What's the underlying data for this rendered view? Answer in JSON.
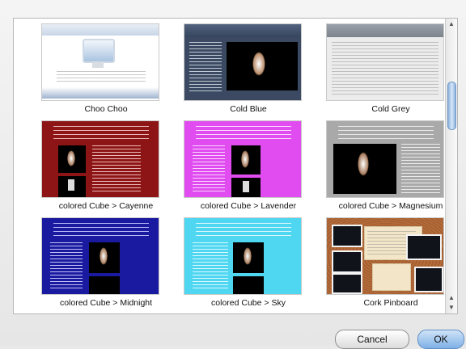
{
  "templates": [
    {
      "label": "Choo Choo",
      "style": "choo"
    },
    {
      "label": "Cold Blue",
      "style": "coldblue"
    },
    {
      "label": "Cold Grey",
      "style": "coldgrey"
    },
    {
      "label": "colored Cube > Cayenne",
      "style": "cayenne"
    },
    {
      "label": "colored Cube > Lavender",
      "style": "lavender"
    },
    {
      "label": "colored Cube > Magnesium",
      "style": "magnesium"
    },
    {
      "label": "colored Cube > Midnight",
      "style": "midnight"
    },
    {
      "label": "colored Cube > Sky",
      "style": "sky"
    },
    {
      "label": "Cork Pinboard",
      "style": "cork"
    }
  ],
  "buttons": {
    "cancel": "Cancel",
    "ok": "OK"
  },
  "colors": {
    "cayenne": "#8e1515",
    "lavender": "#e04cf0",
    "magnesium": "#a9a9a9",
    "midnight": "#1a1aa0",
    "sky": "#4fd7f2",
    "coldblue": "#3b4a62",
    "cork": "#b4693a"
  }
}
